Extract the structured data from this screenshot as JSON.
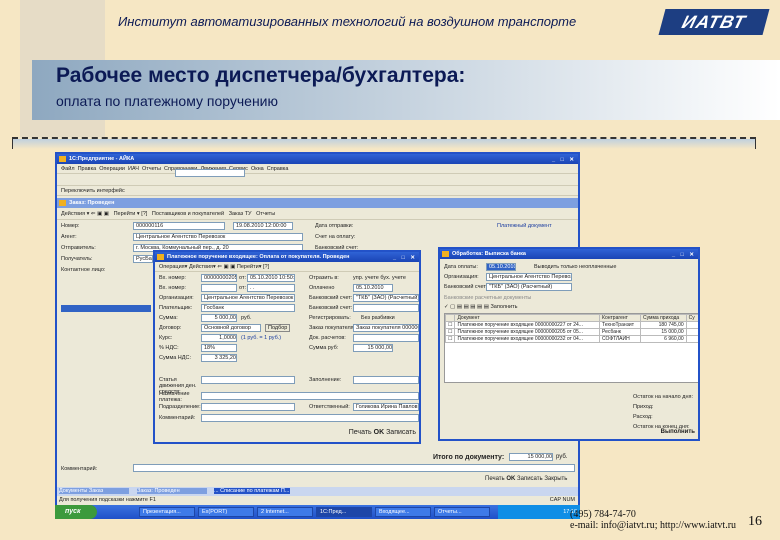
{
  "slide": {
    "institute": "Институт автоматизированных технологий на воздушном транспорте",
    "logo_text": "ИАТВТ",
    "title": "Рабочее место диспетчера/бухгалтера:",
    "subtitle": "оплата по платежному поручению",
    "phone": "(495) 784-74-70",
    "contacts": "e-mail: info@iatvt.ru; http://www.iatvt.ru",
    "page_number": "16"
  },
  "app": {
    "title": "1С:Предприятие - АЙКА",
    "menu": [
      "Файл",
      "Правка",
      "Операции",
      "ИАЧ",
      "Отчеты",
      "Справочники",
      "Движения",
      "Сервис",
      "Окна",
      "Справка"
    ],
    "panel": "Переключить интерфейс",
    "doc_title": "Заказ: Проведен",
    "doc_toolbar": [
      "Действия",
      "Перейти",
      "Поставщиков и покупателей",
      "Заказ ТУ",
      "Отчеты"
    ],
    "doc_fields": [
      {
        "label": "Номер:",
        "value": "000000116",
        "date": "19.08.2010 12:00:00"
      },
      {
        "label": "Агент:",
        "value": "Центральное Агентство Перевозок"
      },
      {
        "label": "Отправитель:",
        "value": "г. Москва, Коммунальный пер., д. 20"
      },
      {
        "label": "Получатель:",
        "value": "РусБанк"
      },
      {
        "label": "Контактное лицо:",
        "value": ""
      }
    ],
    "right_labels": [
      "Дата отправки:",
      "Счет на оплату:",
      "Банковский счет:"
    ],
    "print_link": "Платежный документ",
    "total_label": "Итого по документу:",
    "total_value": "15 000,00",
    "currency": "руб.",
    "comment_label": "Комментарий:",
    "buttons": [
      "Печать",
      "OK",
      "Записать",
      "Закрыть"
    ],
    "window_tabs": [
      "Документы Заказ",
      "Заказ: Проведен",
      "... Списание по платежам П..."
    ],
    "status": "Для получения подсказки нажмите F1",
    "status_right": "CAP  NUM"
  },
  "payment_dialog": {
    "title": "Платежное поручение входящее: Оплата от покупателя. Проведен",
    "toolbar": [
      "Операция",
      "Действия",
      "Перейти"
    ],
    "left": [
      {
        "label": "Вх. номер:",
        "value": "00000000205",
        "from": "от:",
        "date": "05.10.2010 10:50:54"
      },
      {
        "label": "Вх. номер:",
        "value": "",
        "from": "от:",
        "date": ". ."
      },
      {
        "label": "Организация:",
        "value": "Центральное Агентство Перевозок"
      },
      {
        "label": "Плательщик:",
        "value": "Госбанк"
      },
      {
        "label": "Сумма:",
        "value": "5 000,00",
        "unit": "руб."
      },
      {
        "label": "Договор:",
        "value": "Основной договор",
        "button": "Подбор"
      },
      {
        "label": "Курс:",
        "value": "1,0000",
        "unit": "(1 руб. = 1 руб.)"
      },
      {
        "label": "% НДС:",
        "value": "18%"
      },
      {
        "label": "Сумма НДС:",
        "value": "3 325,20"
      }
    ],
    "right": [
      {
        "label": "Отразить в:",
        "value": "упр. учете  бух. учете"
      },
      {
        "label": "Оплачено",
        "value": "05.10.2010"
      },
      {
        "label": "Банковский счет:",
        "value": "\"ТКБ\" (ЗАО) (Расчетный)"
      },
      {
        "label": "Банковский счет:",
        "value": ""
      },
      {
        "label": "Регистрировать:",
        "value": "Без разбивки"
      },
      {
        "label": "Заказ покупателя:",
        "value": "Заказ покупателя 000000001"
      },
      {
        "label": "Док. расчетов:",
        "value": ""
      },
      {
        "label": "Сумма руб:",
        "value": "15 000,00"
      }
    ],
    "bottom": [
      {
        "label": "Статья движения ден. средств:",
        "value": ""
      },
      {
        "label": "Назначение платежа:",
        "value": ""
      },
      {
        "label": "Подразделение:",
        "value": ""
      },
      {
        "label": "Комментарий:",
        "value": ""
      }
    ],
    "responsible_label": "Ответственный:",
    "responsible_value": "Голикова Ирина Павловна",
    "collapse_label": "Заполнение:",
    "buttons": [
      "Печать",
      "OK",
      "Записать"
    ]
  },
  "statement_dialog": {
    "title": "Обработка: Выписка банка",
    "date_label": "Дата оплаты:",
    "date_value": "05.10.2010",
    "only_unpaid": "Выводить только неоплаченные",
    "org_label": "Организация:",
    "org_value": "Центральное Агентство Перевозок",
    "account_label": "Банковский счет:",
    "account_value": "\"ТКБ\" (ЗАО) (Расчетный)",
    "section": "Банковские расчетные документы",
    "fill_button": "Заполнить",
    "columns": [
      "Документ",
      "Контрагент",
      "Сумма прихода",
      "Су"
    ],
    "rows": [
      {
        "doc": "Платежное поручение входящее 00000000227 от 24...",
        "party": "ТехноТранзит",
        "sum": "180 745,00"
      },
      {
        "doc": "Платежное поручение входящее 00000000205 от 05...",
        "party": "Ресбанк",
        "sum": "15 000,00"
      },
      {
        "doc": "Платежное поручение входящее 00000000232 от 04...",
        "party": "СОФТЛАЙН",
        "sum": "6 960,00"
      }
    ],
    "totals": [
      "Остаток на начало дня:",
      "Приход:",
      "Расход:",
      "Остаток на конец дня:"
    ],
    "run_button": "Выполнить"
  },
  "taskbar": {
    "start": "пуск",
    "items": [
      "Презентация...",
      "Ex(PORT)",
      "2 Internet...",
      "1С:Пред...",
      "Входящее...",
      "Отчеты..."
    ],
    "clock": "17:10"
  }
}
